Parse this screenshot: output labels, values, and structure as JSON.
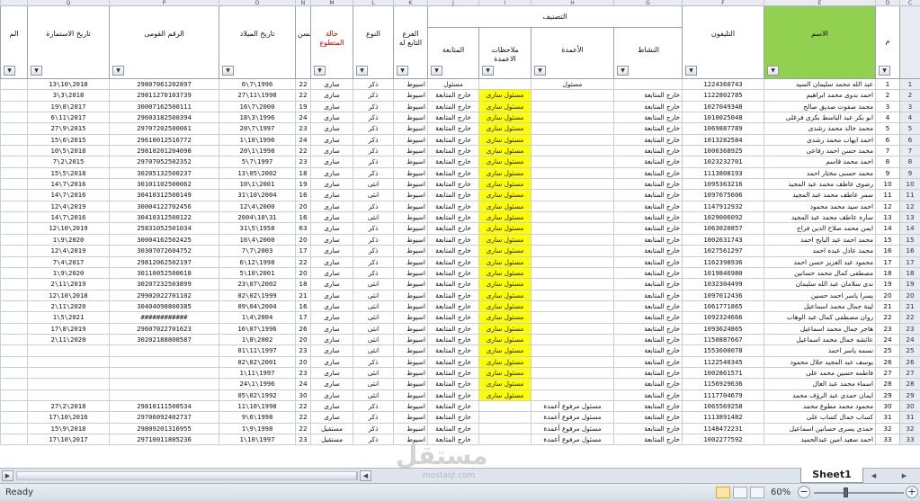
{
  "app": {
    "status_text": "Ready",
    "zoom": "60%",
    "sheet_tab": "Sheet1",
    "watermark": "مستقل",
    "watermark_sub": "mostaql.com"
  },
  "col_letters": [
    "",
    "Q",
    "P",
    "O",
    "N",
    "M",
    "L",
    "K",
    "J",
    "I",
    "H",
    "G",
    "F",
    "E",
    "D",
    "C",
    "B",
    "A",
    ""
  ],
  "headers": {
    "extra": "الم",
    "form_date": "تاريخ الاستمارة",
    "national_id": "الرقم القومى",
    "birth_date": "تاريخ الميلاد",
    "age": "السن",
    "volunteer_status": "حالة المتطوع",
    "gender": "النوع",
    "branch": "الفرع التابع له",
    "classification": "التصنيف",
    "followup": "المتابعة",
    "column_notes": "ملاحظات الاعمدة",
    "columns": "الأعمدة",
    "activity": "النشاط",
    "phone": "التليفون",
    "name": "الاسم",
    "rownum": "م"
  },
  "rows": [
    {
      "n": "1",
      "name": "عبد الله محمد سليمان السيد",
      "phone": "1224360743",
      "activity": "",
      "columns": "مسئول",
      "notes": "",
      "follow": "مسئول",
      "branch": "اسيوط",
      "gender": "ذكر",
      "status": "سارى",
      "age": "22",
      "birth": "6\\7\\1996",
      "nid": "29807061202897",
      "form": "13\\10\\2018",
      "y": false
    },
    {
      "n": "2",
      "name": "احمد بدوى محمد ابراهيم",
      "phone": "1122802785",
      "activity": "خارج المتابعة",
      "columns": "",
      "notes": "مسئول سارى",
      "follow": "خارج المتابعة",
      "branch": "اسيوط",
      "gender": "ذكر",
      "status": "سارى",
      "age": "22",
      "birth": "27\\11\\1998",
      "nid": "29811270103739",
      "form": "3\\3\\2018",
      "y": true
    },
    {
      "n": "3",
      "name": "محمد صفوت صديق صالح",
      "phone": "1027049348",
      "activity": "خارج المتابعة",
      "columns": "",
      "notes": "مسئول سارى",
      "follow": "خارج المتابعة",
      "branch": "اسيوط",
      "gender": "ذكر",
      "status": "سارى",
      "age": "19",
      "birth": "16\\7\\2000",
      "nid": "30007162500111",
      "form": "19\\8\\2017",
      "y": true
    },
    {
      "n": "4",
      "name": "ابو بكر عبد الباسط بكرى فرغلى",
      "phone": "1010025048",
      "activity": "خارج المتابعة",
      "columns": "",
      "notes": "مسئول سارى",
      "follow": "خارج المتابعة",
      "branch": "اسيوط",
      "gender": "ذكر",
      "status": "سارى",
      "age": "24",
      "birth": "18\\3\\1996",
      "nid": "29603182500394",
      "form": "6\\11\\2017",
      "y": true
    },
    {
      "n": "5",
      "name": "محمد خالد محمد رشدى",
      "phone": "1069887789",
      "activity": "خارج المتابعة",
      "columns": "",
      "notes": "مسئول سارى",
      "follow": "خارج المتابعة",
      "branch": "اسيوط",
      "gender": "ذكر",
      "status": "سارى",
      "age": "23",
      "birth": "20\\7\\1997",
      "nid": "29707202500061",
      "form": "27\\9\\2015",
      "y": true
    },
    {
      "n": "6",
      "name": "احمد ايهاب محمد رشدى",
      "phone": "1013282584",
      "activity": "خارج المتابعة",
      "columns": "",
      "notes": "مسئول سارى",
      "follow": "خارج المتابعة",
      "branch": "اسيوط",
      "gender": "ذكر",
      "status": "سارى",
      "age": "24",
      "birth": "1\\10\\1996",
      "nid": "29610012516772",
      "form": "15\\6\\2015",
      "y": true
    },
    {
      "n": "7",
      "name": "محمد حسن احمد رفاعى",
      "phone": "1006368925",
      "activity": "خارج المتابعة",
      "columns": "",
      "notes": "مسئول سارى",
      "follow": "خارج المتابعة",
      "branch": "اسيوط",
      "gender": "ذكر",
      "status": "سارى",
      "age": "22",
      "birth": "20\\1\\1998",
      "nid": "29810201204098",
      "form": "10\\5\\2018",
      "y": true
    },
    {
      "n": "8",
      "name": "احمد محمد قاسم",
      "phone": "1023232701",
      "activity": "خارج المتابعة",
      "columns": "",
      "notes": "مسئول سارى",
      "follow": "خارج المتابعة",
      "branch": "اسيوط",
      "gender": "ذكر",
      "status": "سارى",
      "age": "23",
      "birth": "5\\7\\1997",
      "nid": "29707052502352",
      "form": "7\\2\\2015",
      "y": true
    },
    {
      "n": "9",
      "name": "محمد حسنى مختار احمد",
      "phone": "1113808193",
      "activity": "خارج المتابعة",
      "columns": "",
      "notes": "مسئول سارى",
      "follow": "خارج المتابعة",
      "branch": "اسيوط",
      "gender": "ذكر",
      "status": "سارى",
      "age": "18",
      "birth": "13\\05\\2002",
      "nid": "30205132500237",
      "form": "15\\5\\2018",
      "y": true
    },
    {
      "n": "10",
      "name": "رضوى عاطف محمد عبد المجيد",
      "phone": "1095363216",
      "activity": "خارج المتابعة",
      "columns": "",
      "notes": "مسئول سارى",
      "follow": "خارج المتابعة",
      "branch": "اسيوط",
      "gender": "انثى",
      "status": "سارى",
      "age": "19",
      "birth": "10\\1\\2001",
      "nid": "30101102500062",
      "form": "14\\7\\2016",
      "y": true
    },
    {
      "n": "11",
      "name": "سمر عاطف محمد عبد المجيد",
      "phone": "1097675606",
      "activity": "خارج المتابعة",
      "columns": "",
      "notes": "مسئول سارى",
      "follow": "خارج المتابعة",
      "branch": "اسيوط",
      "gender": "انثى",
      "status": "سارى",
      "age": "16",
      "birth": "31\\10\\2004",
      "nid": "30410312500149",
      "form": "14\\7\\2016",
      "y": true
    },
    {
      "n": "12",
      "name": "احمد سيد محمد محمود",
      "phone": "1147912932",
      "activity": "خارج المتابعة",
      "columns": "",
      "notes": "مسئول سارى",
      "follow": "خارج المتابعة",
      "branch": "اسيوط",
      "gender": "ذكر",
      "status": "سارى",
      "age": "20",
      "birth": "12\\4\\2000",
      "nid": "30004122702456",
      "form": "12\\4\\2019",
      "y": true
    },
    {
      "n": "13",
      "name": "ساره عاطف محمد عبد المجيد",
      "phone": "1029006092",
      "activity": "خارج المتابعة",
      "columns": "",
      "notes": "مسئول سارى",
      "follow": "خارج المتابعة",
      "branch": "اسيوط",
      "gender": "انثى",
      "status": "سارى",
      "age": "16",
      "birth": "2004\\10\\31",
      "nid": "30410312500122",
      "form": "14\\7\\2016",
      "y": true
    },
    {
      "n": "14",
      "name": "ايمن محمد صلاح الدين فراج",
      "phone": "1063020857",
      "activity": "خارج المتابعة",
      "columns": "",
      "notes": "مسئول سارى",
      "follow": "خارج المتابعة",
      "branch": "اسيوط",
      "gender": "ذكر",
      "status": "سارى",
      "age": "63",
      "birth": "31\\5\\1958",
      "nid": "25831052501034",
      "form": "12\\10\\2019",
      "y": true
    },
    {
      "n": "15",
      "name": "محمد احمد عبد البايح احمد",
      "phone": "1002631743",
      "activity": "خارج المتابعة",
      "columns": "",
      "notes": "مسئول سارى",
      "follow": "خارج المتابعة",
      "branch": "اسيوط",
      "gender": "ذكر",
      "status": "سارى",
      "age": "20",
      "birth": "16\\4\\2000",
      "nid": "30004162502425",
      "form": "1\\9\\2020",
      "y": true
    },
    {
      "n": "16",
      "name": "محمد عادل عبده احمد",
      "phone": "1027561297",
      "activity": "خارج المتابعة",
      "columns": "",
      "notes": "مسئول سارى",
      "follow": "خارج المتابعة",
      "branch": "اسيوط",
      "gender": "ذكر",
      "status": "سارى",
      "age": "17",
      "birth": "7\\7\\2003",
      "nid": "30307072604752",
      "form": "12\\4\\2019",
      "y": true
    },
    {
      "n": "17",
      "name": "محمود عبد العزيز حسن احمد",
      "phone": "1162398936",
      "activity": "خارج المتابعة",
      "columns": "",
      "notes": "مسئول سارى",
      "follow": "خارج المتابعة",
      "branch": "اسيوط",
      "gender": "ذكر",
      "status": "سارى",
      "age": "22",
      "birth": "6\\12\\1998",
      "nid": "29812062502197",
      "form": "7\\4\\2017",
      "y": true
    },
    {
      "n": "18",
      "name": "مصطفى كمال محمد حسانين",
      "phone": "1019846980",
      "activity": "خارج المتابعة",
      "columns": "",
      "notes": "مسئول سارى",
      "follow": "خارج المتابعة",
      "branch": "اسيوط",
      "gender": "ذكر",
      "status": "سارى",
      "age": "20",
      "birth": "5\\10\\2001",
      "nid": "30110052500618",
      "form": "1\\9\\2020",
      "y": true
    },
    {
      "n": "19",
      "name": "ندى سلامان عبد الله سليمان",
      "phone": "1032304499",
      "activity": "خارج المتابعة",
      "columns": "",
      "notes": "مسئول سارى",
      "follow": "خارج المتابعة",
      "branch": "اسيوط",
      "gender": "انثى",
      "status": "سارى",
      "age": "18",
      "birth": "23\\07\\2002",
      "nid": "30207232503899",
      "form": "2\\11\\2019",
      "y": true
    },
    {
      "n": "20",
      "name": "يسرا ياسر احمد حسين",
      "phone": "1097012436",
      "activity": "خارج المتابعة",
      "columns": "",
      "notes": "مسئول سارى",
      "follow": "خارج المتابعة",
      "branch": "اسيوط",
      "gender": "انثى",
      "status": "سارى",
      "age": "21",
      "birth": "02\\02\\1999",
      "nid": "29902022701102",
      "form": "12\\10\\2018",
      "y": true
    },
    {
      "n": "21",
      "name": "لينة جمال محمد اسماعيل",
      "phone": "1061771865",
      "activity": "خارج المتابعة",
      "columns": "",
      "notes": "مسئول سارى",
      "follow": "خارج المتابعة",
      "branch": "اسيوط",
      "gender": "انثى",
      "status": "سارى",
      "age": "16",
      "birth": "09\\04\\2004",
      "nid": "30404098800385",
      "form": "2\\11\\2020",
      "y": true
    },
    {
      "n": "22",
      "name": "روان مصطفى كمال عبد الوهاب",
      "phone": "1092324666",
      "activity": "خارج المتابعة",
      "columns": "",
      "notes": "مسئول سارى",
      "follow": "خارج المتابعة",
      "branch": "اسيوط",
      "gender": "انثى",
      "status": "سارى",
      "age": "17",
      "birth": "1\\4\\2004",
      "nid": "############",
      "form": "1\\5\\2021",
      "y": true
    },
    {
      "n": "23",
      "name": "هاجر جمال محمد اسماعيل",
      "phone": "1093624865",
      "activity": "خارج المتابعة",
      "columns": "",
      "notes": "مسئول سارى",
      "follow": "خارج المتابعة",
      "branch": "اسيوط",
      "gender": "انثى",
      "status": "سارى",
      "age": "26",
      "birth": "16\\07\\1996",
      "nid": "29607022701623",
      "form": "17\\8\\2019",
      "y": true
    },
    {
      "n": "24",
      "name": "عائشه جمال محمد اسماعيل",
      "phone": "1150887667",
      "activity": "خارج المتابعة",
      "columns": "",
      "notes": "مسئول سارى",
      "follow": "خارج المتابعة",
      "branch": "اسيوط",
      "gender": "انثى",
      "status": "سارى",
      "age": "20",
      "birth": "1\\8\\2002",
      "nid": "30202188800587",
      "form": "2\\11\\2020",
      "y": true
    },
    {
      "n": "25",
      "name": "نسمه ياسر احمد",
      "phone": "1553600078",
      "activity": "خارج المتابعة",
      "columns": "",
      "notes": "مسئول سارى",
      "follow": "خارج المتابعة",
      "branch": "اسيوط",
      "gender": "انثى",
      "status": "سارى",
      "age": "23",
      "birth": "01\\11\\1997",
      "nid": "",
      "form": "",
      "y": true
    },
    {
      "n": "26",
      "name": "يوسف عبد المجيد جلال محمود",
      "phone": "1122540345",
      "activity": "خارج المتابعة",
      "columns": "",
      "notes": "مسئول سارى",
      "follow": "خارج المتابعة",
      "branch": "اسيوط",
      "gender": "ذكر",
      "status": "سارى",
      "age": "20",
      "birth": "02\\02\\2001",
      "nid": "",
      "form": "",
      "y": true
    },
    {
      "n": "27",
      "name": "فاطمه حسين محمد على",
      "phone": "1002861571",
      "activity": "خارج المتابعة",
      "columns": "",
      "notes": "مسئول سارى",
      "follow": "خارج المتابعة",
      "branch": "اسيوط",
      "gender": "انثى",
      "status": "سارى",
      "age": "23",
      "birth": "1\\11\\1997",
      "nid": "",
      "form": "",
      "y": true
    },
    {
      "n": "28",
      "name": "اسماء محمد عبد العال",
      "phone": "1156929636",
      "activity": "خارج المتابعة",
      "columns": "",
      "notes": "مسئول سارى",
      "follow": "خارج المتابعة",
      "branch": "اسيوط",
      "gender": "انثى",
      "status": "سارى",
      "age": "24",
      "birth": "24\\1\\1996",
      "nid": "",
      "form": "",
      "y": true
    },
    {
      "n": "29",
      "name": "ايمان حمدى عبد الرؤف محمد",
      "phone": "1117704679",
      "activity": "خارج المتابعة",
      "columns": "",
      "notes": "مسئول سارى",
      "follow": "خارج المتابعة",
      "branch": "اسيوط",
      "gender": "انثى",
      "status": "سارى",
      "age": "30",
      "birth": "05\\02\\1992",
      "nid": "",
      "form": "",
      "y": true
    },
    {
      "n": "30",
      "name": "محمود محمد مطوع محمد",
      "phone": "1065569258",
      "activity": "خارج المتابعة",
      "columns": "مسئول مرفوع أعمدة",
      "notes": "",
      "follow": "خارج المتابعة",
      "branch": "اسيوط",
      "gender": "ذكر",
      "status": "سارى",
      "age": "22",
      "birth": "11\\10\\1998",
      "nid": "29810111500534",
      "form": "27\\2\\2018",
      "y": false
    },
    {
      "n": "31",
      "name": "كساب جمال كساب على",
      "phone": "1113891482",
      "activity": "خارج المتابعة",
      "columns": "مسئول مرفوع أعمدة",
      "notes": "",
      "follow": "خارج المتابعة",
      "branch": "اسيوط",
      "gender": "ذكر",
      "status": "سارى",
      "age": "22",
      "birth": "9\\6\\1998",
      "nid": "29706092402737",
      "form": "17\\10\\2016",
      "y": false
    },
    {
      "n": "32",
      "name": "حمدى يسرى حسانين اسماعيل",
      "phone": "1148472231",
      "activity": "خارج المتابعة",
      "columns": "مسئول مرفوع أعمدة",
      "notes": "",
      "follow": "خارج المتابعة",
      "branch": "اسيوط",
      "gender": "ذكر",
      "status": "مستقيل",
      "age": "22",
      "birth": "1\\9\\1998",
      "nid": "29809201316955",
      "form": "15\\9\\2018",
      "y": false
    },
    {
      "n": "33",
      "name": "احمد سعيد امين عبدالحميد",
      "phone": "1002277592",
      "activity": "خارج المتابعة",
      "columns": "مسئول مرفوع أعمدة",
      "notes": "",
      "follow": "خارج المتابعة",
      "branch": "اسيوط",
      "gender": "ذكر",
      "status": "مستقيل",
      "age": "23",
      "birth": "1\\10\\1997",
      "nid": "29710011805236",
      "form": "17\\10\\2017",
      "y": false
    }
  ]
}
